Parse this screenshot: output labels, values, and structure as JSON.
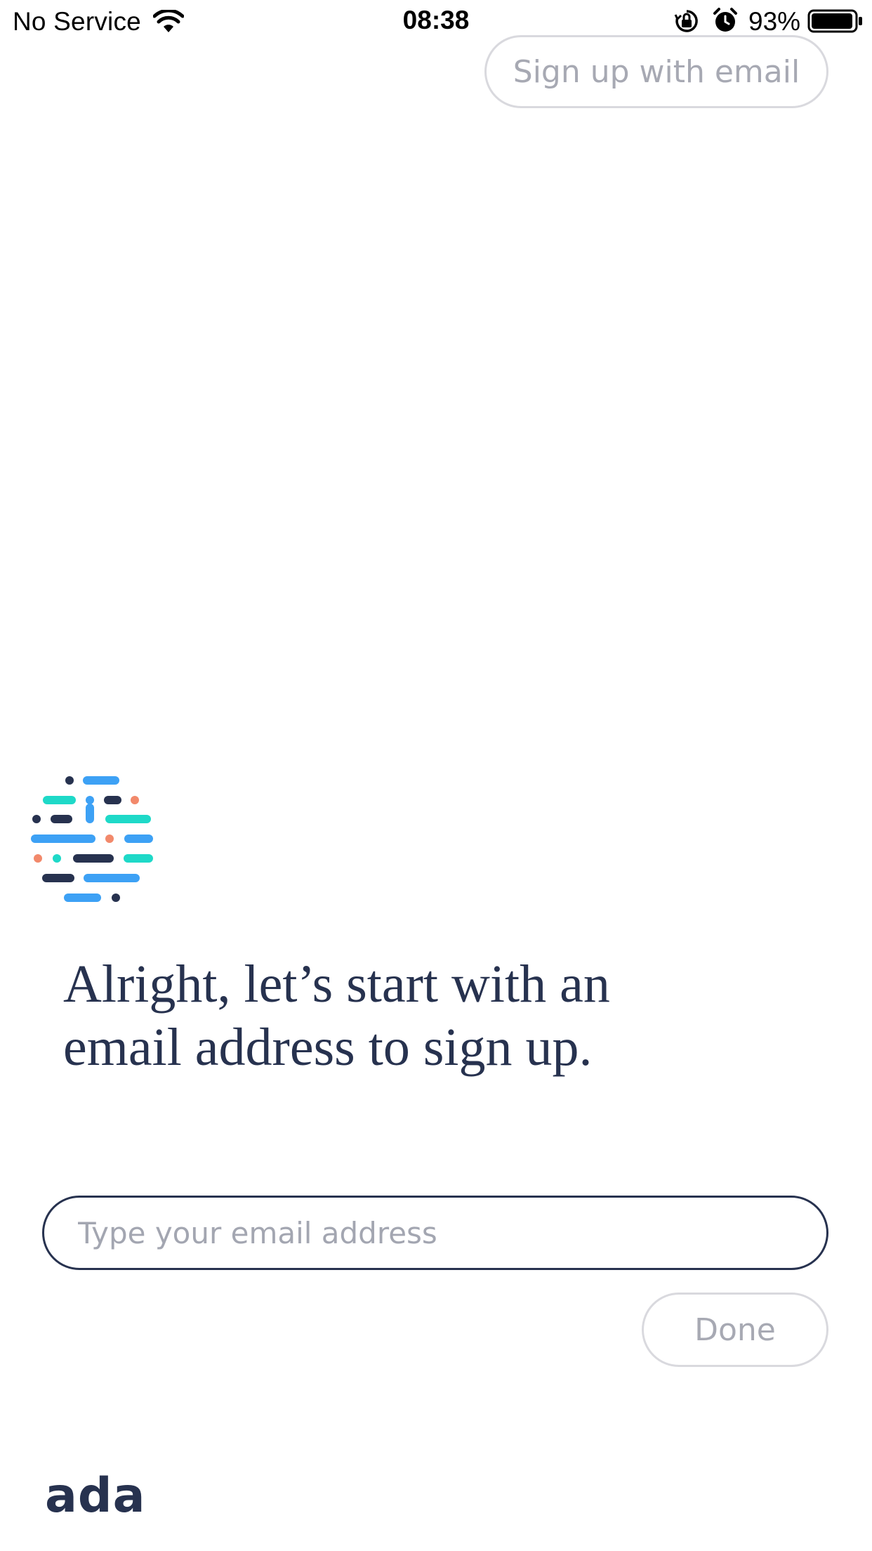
{
  "status_bar": {
    "carrier": "No Service",
    "time": "08:38",
    "battery_percent": "93%",
    "icons": [
      "wifi-icon",
      "orientation-lock-icon",
      "alarm-icon",
      "battery-icon"
    ]
  },
  "header": {
    "signup_email_label": "Sign up with email"
  },
  "chat": {
    "prompt": "Alright, let’s start with an email address to sign up.",
    "email_placeholder": "Type your email address",
    "email_value": "",
    "done_label": "Done"
  },
  "footer": {
    "brand": "ada"
  },
  "colors": {
    "navy": "#27324f",
    "blue": "#3da1f5",
    "teal": "#1ed9c8",
    "coral": "#f2896b",
    "muted_gray": "#a7a9b3",
    "pill_border": "#d9d9de"
  }
}
